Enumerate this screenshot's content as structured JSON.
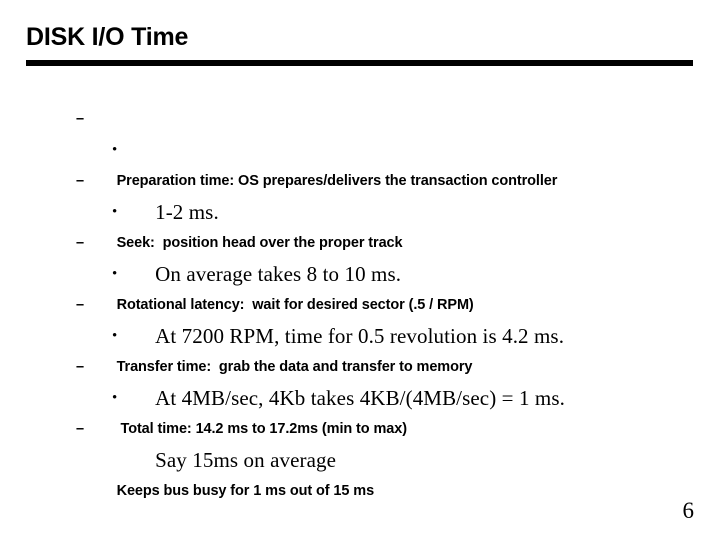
{
  "slide": {
    "title": "DISK I/O Time",
    "page_number": "6",
    "bullet_glyphs": {
      "level1": "–",
      "level2": "•"
    },
    "colors": {
      "text": "#000000",
      "background": "#ffffff",
      "rule": "#000000"
    },
    "lines": [
      {
        "level": 1,
        "text": "Preparation time: OS prepares/delivers the transaction controller"
      },
      {
        "level": 2,
        "text": "1-2 ms."
      },
      {
        "level": 1,
        "text": "Seek:  position head over the proper track"
      },
      {
        "level": 2,
        "text": "On average takes 8 to 10 ms."
      },
      {
        "level": 1,
        "text": "Rotational latency:  wait for desired sector (.5 / RPM)"
      },
      {
        "level": 2,
        "text": "At 7200 RPM, time for 0.5 revolution is 4.2 ms."
      },
      {
        "level": 1,
        "text": "Transfer time:  grab the data and transfer to memory"
      },
      {
        "level": 2,
        "text": "At 4MB/sec, 4Kb takes 4KB/(4MB/sec) = 1 ms."
      },
      {
        "level": 1,
        "text": " Total time: 14.2 ms to 17.2ms (min to max)"
      },
      {
        "level": 2,
        "text": "Say 15ms on average"
      },
      {
        "level": 1,
        "text": "Keeps bus busy for 1 ms out of 15 ms"
      }
    ]
  }
}
